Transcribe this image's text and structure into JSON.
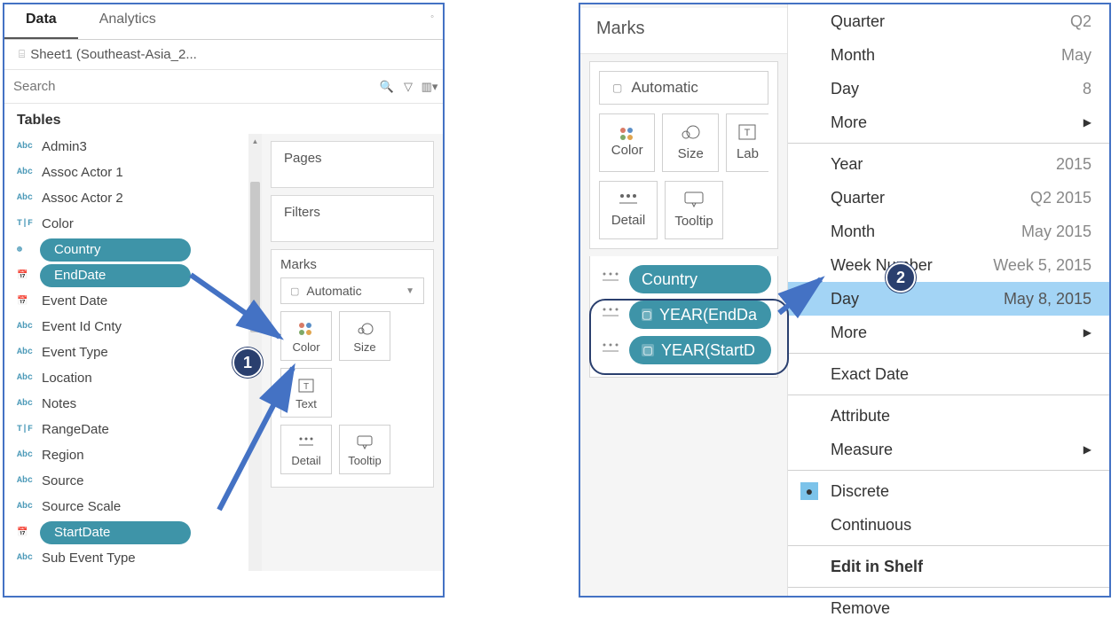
{
  "left": {
    "tabs": {
      "data": "Data",
      "analytics": "Analytics"
    },
    "datasource": "Sheet1 (Southeast-Asia_2...",
    "search_placeholder": "Search",
    "tables_header": "Tables",
    "fields": [
      {
        "name": "Admin3",
        "type": "str"
      },
      {
        "name": "Assoc Actor 1",
        "type": "str"
      },
      {
        "name": "Assoc Actor 2",
        "type": "str"
      },
      {
        "name": "Color",
        "type": "tf"
      },
      {
        "name": "Country",
        "type": "geo",
        "pill": true
      },
      {
        "name": "EndDate",
        "type": "dt",
        "pill": true
      },
      {
        "name": "Event Date",
        "type": "dt"
      },
      {
        "name": "Event Id Cnty",
        "type": "str"
      },
      {
        "name": "Event Type",
        "type": "str"
      },
      {
        "name": "Location",
        "type": "str"
      },
      {
        "name": "Notes",
        "type": "str"
      },
      {
        "name": "RangeDate",
        "type": "tf"
      },
      {
        "name": "Region",
        "type": "str"
      },
      {
        "name": "Source",
        "type": "str"
      },
      {
        "name": "Source Scale",
        "type": "str"
      },
      {
        "name": "StartDate",
        "type": "dt",
        "pill": true
      },
      {
        "name": "Sub Event Type",
        "type": "str"
      }
    ],
    "shelves": {
      "pages": "Pages",
      "filters": "Filters"
    },
    "marks": {
      "title": "Marks",
      "auto": "Automatic",
      "buttons": {
        "color": "Color",
        "size": "Size",
        "text": "Text",
        "detail": "Detail",
        "tooltip": "Tooltip"
      }
    },
    "badge1": "1"
  },
  "right": {
    "marks_title": "Marks",
    "auto": "Automatic",
    "buttons": {
      "color": "Color",
      "size": "Size",
      "label": "Lab",
      "detail": "Detail",
      "tooltip": "Tooltip"
    },
    "pills": {
      "country": "Country",
      "end": "YEAR(EndDa",
      "start": "YEAR(StartD"
    },
    "menu": {
      "quarter1": {
        "label": "Quarter",
        "val": "Q2"
      },
      "month1": {
        "label": "Month",
        "val": "May"
      },
      "day1": {
        "label": "Day",
        "val": "8"
      },
      "more1": "More",
      "year2": {
        "label": "Year",
        "val": "2015"
      },
      "quarter2": {
        "label": "Quarter",
        "val": "Q2 2015"
      },
      "month2": {
        "label": "Month",
        "val": "May 2015"
      },
      "week2": {
        "label": "Week Number",
        "val": "Week 5, 2015"
      },
      "day2": {
        "label": "Day",
        "val": "May 8, 2015"
      },
      "more2": "More",
      "exact": "Exact Date",
      "attribute": "Attribute",
      "measure": "Measure",
      "discrete": "Discrete",
      "continuous": "Continuous",
      "edit": "Edit in Shelf",
      "remove": "Remove"
    },
    "badge2": "2"
  }
}
